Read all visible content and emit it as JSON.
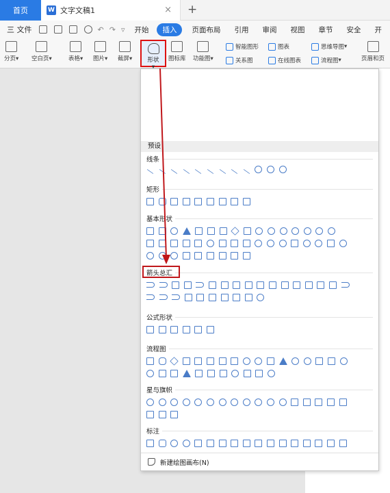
{
  "tabs": {
    "home": "首页",
    "document_title": "文字文稿1",
    "close": "×",
    "add": "+"
  },
  "menu": {
    "file": "三 文件",
    "redo_glyph": "↶",
    "items": [
      "开始",
      "插入",
      "页面布局",
      "引用",
      "审阅",
      "视图",
      "章节",
      "安全",
      "开"
    ]
  },
  "ribbon": {
    "page_break": "分页",
    "blank_page": "空白页",
    "table": "表格",
    "picture": "图片",
    "screenshot": "截屏",
    "shape": "形状",
    "icon_lib": "图标库",
    "func_chart": "功能图",
    "smart_art": "智能图形",
    "chart": "图表",
    "mind_map": "思维导图",
    "relation": "关系图",
    "online_chart": "在线图表",
    "flowchart": "流程图",
    "header_footer": "页眉和页"
  },
  "panel": {
    "preset": "预设",
    "categories": {
      "lines": "线条",
      "rect": "矩形",
      "basic": "基本形状",
      "arrows": "箭头总汇",
      "formula": "公式形状",
      "flow": "流程图",
      "stars": "星与旗帜",
      "callouts": "标注"
    },
    "new_canvas": "新建绘图画布(N)"
  },
  "colors": {
    "accent": "#2a7be4",
    "annotation": "#c0171b",
    "shape_stroke": "#4a7cc7"
  }
}
